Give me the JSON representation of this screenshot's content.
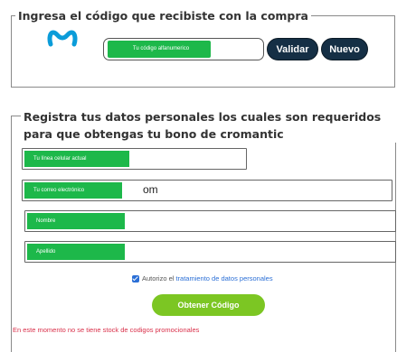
{
  "code_section": {
    "legend": "Ingresa el código que recibiste con la compra",
    "code_placeholder": "Tu código alfanumerico",
    "validate_label": "Validar",
    "new_label": "Nuevo"
  },
  "register_section": {
    "legend": "Registra tus datos personales los cuales son requeridos para que obtengas tu bono de cromantic",
    "fields": {
      "linea": {
        "label": "Tu línea celular actual",
        "value": ""
      },
      "correo": {
        "label": "Tu correo electrónico",
        "value": "om"
      },
      "nombre": {
        "label": "Nombre",
        "value": ""
      },
      "apellido": {
        "label": "Apellido",
        "value": ""
      }
    },
    "consent": {
      "prefix": "Autorizo el",
      "link": "tratamiento de datos personales",
      "checked": true
    },
    "submit_label": "Obtener Código",
    "stock_message": "En este momento no se tiene stock de codigos promocionales"
  },
  "colors": {
    "brand_green": "#1db84a",
    "lime_button": "#7cc623",
    "navy_button": "#152f45",
    "logo_blue": "#0b9cd9",
    "error_red": "#d9304a",
    "link_blue": "#2b6fd6"
  },
  "icons": {
    "logo": "movistar-m-logo",
    "checkbox": "checkbox-checked-icon"
  }
}
